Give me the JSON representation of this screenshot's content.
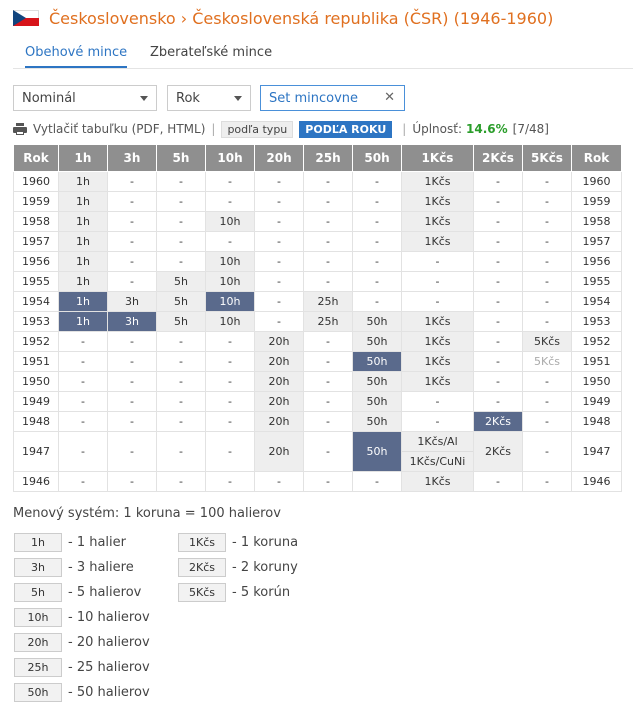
{
  "header": {
    "title": "Československo › Československá republika (ČSR) (1946-1960)",
    "flag": "czechoslovakia-flag"
  },
  "tabs": [
    "Obehové mince",
    "Zberateľské mince"
  ],
  "filters": {
    "nominal": "Nominál",
    "year": "Rok",
    "set": "Set mincovne"
  },
  "toolbar": {
    "print": "Vytlačiť tabuľku (PDF, HTML)",
    "by_type": "podľa typu",
    "by_year": "PODĽA ROKU",
    "completeness_label": "Úplnosť:",
    "completeness_pct": "14.6%",
    "completeness_count": "[7/48]"
  },
  "table": {
    "headers": [
      "Rok",
      "1h",
      "3h",
      "5h",
      "10h",
      "20h",
      "25h",
      "50h",
      "1Kčs",
      "2Kčs",
      "5Kčs",
      "Rok"
    ],
    "rows": [
      {
        "year": "1960",
        "cells": [
          {
            "t": "1h",
            "s": "owned"
          },
          {
            "t": "-"
          },
          {
            "t": "-"
          },
          {
            "t": "-"
          },
          {
            "t": "-"
          },
          {
            "t": "-"
          },
          {
            "t": "-"
          },
          {
            "t": "1Kčs",
            "s": "owned"
          },
          {
            "t": "-"
          },
          {
            "t": "-"
          }
        ]
      },
      {
        "year": "1959",
        "cells": [
          {
            "t": "1h",
            "s": "owned"
          },
          {
            "t": "-"
          },
          {
            "t": "-"
          },
          {
            "t": "-"
          },
          {
            "t": "-"
          },
          {
            "t": "-"
          },
          {
            "t": "-"
          },
          {
            "t": "1Kčs",
            "s": "owned"
          },
          {
            "t": "-"
          },
          {
            "t": "-"
          }
        ]
      },
      {
        "year": "1958",
        "cells": [
          {
            "t": "1h",
            "s": "owned"
          },
          {
            "t": "-"
          },
          {
            "t": "-"
          },
          {
            "t": "10h",
            "s": "owned"
          },
          {
            "t": "-"
          },
          {
            "t": "-"
          },
          {
            "t": "-"
          },
          {
            "t": "1Kčs",
            "s": "owned"
          },
          {
            "t": "-"
          },
          {
            "t": "-"
          }
        ]
      },
      {
        "year": "1957",
        "cells": [
          {
            "t": "1h",
            "s": "owned"
          },
          {
            "t": "-"
          },
          {
            "t": "-"
          },
          {
            "t": "-"
          },
          {
            "t": "-"
          },
          {
            "t": "-"
          },
          {
            "t": "-"
          },
          {
            "t": "1Kčs",
            "s": "owned"
          },
          {
            "t": "-"
          },
          {
            "t": "-"
          }
        ]
      },
      {
        "year": "1956",
        "cells": [
          {
            "t": "1h",
            "s": "owned"
          },
          {
            "t": "-"
          },
          {
            "t": "-"
          },
          {
            "t": "10h",
            "s": "owned"
          },
          {
            "t": "-"
          },
          {
            "t": "-"
          },
          {
            "t": "-"
          },
          {
            "t": "-"
          },
          {
            "t": "-"
          },
          {
            "t": "-"
          }
        ]
      },
      {
        "year": "1955",
        "cells": [
          {
            "t": "1h",
            "s": "owned"
          },
          {
            "t": "-"
          },
          {
            "t": "5h",
            "s": "owned"
          },
          {
            "t": "10h",
            "s": "owned"
          },
          {
            "t": "-"
          },
          {
            "t": "-"
          },
          {
            "t": "-"
          },
          {
            "t": "-"
          },
          {
            "t": "-"
          },
          {
            "t": "-"
          }
        ]
      },
      {
        "year": "1954",
        "cells": [
          {
            "t": "1h",
            "s": "hl"
          },
          {
            "t": "3h",
            "s": "owned"
          },
          {
            "t": "5h",
            "s": "owned"
          },
          {
            "t": "10h",
            "s": "hl"
          },
          {
            "t": "-"
          },
          {
            "t": "25h",
            "s": "owned"
          },
          {
            "t": "-"
          },
          {
            "t": "-"
          },
          {
            "t": "-"
          },
          {
            "t": "-"
          }
        ]
      },
      {
        "year": "1953",
        "cells": [
          {
            "t": "1h",
            "s": "hl"
          },
          {
            "t": "3h",
            "s": "hl"
          },
          {
            "t": "5h",
            "s": "owned"
          },
          {
            "t": "10h",
            "s": "owned"
          },
          {
            "t": "-"
          },
          {
            "t": "25h",
            "s": "owned"
          },
          {
            "t": "50h",
            "s": "owned"
          },
          {
            "t": "1Kčs",
            "s": "owned"
          },
          {
            "t": "-"
          },
          {
            "t": "-"
          }
        ]
      },
      {
        "year": "1952",
        "cells": [
          {
            "t": "-"
          },
          {
            "t": "-"
          },
          {
            "t": "-"
          },
          {
            "t": "-"
          },
          {
            "t": "20h",
            "s": "owned"
          },
          {
            "t": "-"
          },
          {
            "t": "50h",
            "s": "owned"
          },
          {
            "t": "1Kčs",
            "s": "owned"
          },
          {
            "t": "-"
          },
          {
            "t": "5Kčs",
            "s": "owned"
          }
        ]
      },
      {
        "year": "1951",
        "cells": [
          {
            "t": "-"
          },
          {
            "t": "-"
          },
          {
            "t": "-"
          },
          {
            "t": "-"
          },
          {
            "t": "20h",
            "s": "owned"
          },
          {
            "t": "-"
          },
          {
            "t": "50h",
            "s": "hl"
          },
          {
            "t": "1Kčs",
            "s": "owned"
          },
          {
            "t": "-"
          },
          {
            "t": "5Kčs",
            "s": "gray"
          }
        ]
      },
      {
        "year": "1950",
        "cells": [
          {
            "t": "-"
          },
          {
            "t": "-"
          },
          {
            "t": "-"
          },
          {
            "t": "-"
          },
          {
            "t": "20h",
            "s": "owned"
          },
          {
            "t": "-"
          },
          {
            "t": "50h",
            "s": "owned"
          },
          {
            "t": "1Kčs",
            "s": "owned"
          },
          {
            "t": "-"
          },
          {
            "t": "-"
          }
        ]
      },
      {
        "year": "1949",
        "cells": [
          {
            "t": "-"
          },
          {
            "t": "-"
          },
          {
            "t": "-"
          },
          {
            "t": "-"
          },
          {
            "t": "20h",
            "s": "owned"
          },
          {
            "t": "-"
          },
          {
            "t": "50h",
            "s": "owned"
          },
          {
            "t": "-"
          },
          {
            "t": "-"
          },
          {
            "t": "-"
          }
        ]
      },
      {
        "year": "1948",
        "cells": [
          {
            "t": "-"
          },
          {
            "t": "-"
          },
          {
            "t": "-"
          },
          {
            "t": "-"
          },
          {
            "t": "20h",
            "s": "owned"
          },
          {
            "t": "-"
          },
          {
            "t": "50h",
            "s": "owned"
          },
          {
            "t": "-"
          },
          {
            "t": "2Kčs",
            "s": "hl"
          },
          {
            "t": "-"
          }
        ]
      },
      {
        "year": "1947",
        "tall": true,
        "cells": [
          {
            "t": "-"
          },
          {
            "t": "-"
          },
          {
            "t": "-"
          },
          {
            "t": "-"
          },
          {
            "t": "20h",
            "s": "owned"
          },
          {
            "t": "-"
          },
          {
            "t": "50h",
            "s": "hl"
          },
          {
            "t": [
              "1Kčs/Al",
              "1Kčs/CuNi"
            ],
            "s": "owned"
          },
          {
            "t": "2Kčs",
            "s": "owned"
          },
          {
            "t": "-"
          }
        ]
      },
      {
        "year": "1946",
        "cells": [
          {
            "t": "-"
          },
          {
            "t": "-"
          },
          {
            "t": "-"
          },
          {
            "t": "-"
          },
          {
            "t": "-"
          },
          {
            "t": "-"
          },
          {
            "t": "-"
          },
          {
            "t": "1Kčs",
            "s": "owned"
          },
          {
            "t": "-"
          },
          {
            "t": "-"
          }
        ]
      }
    ]
  },
  "legend": {
    "note": "Menový systém: 1 koruna = 100 halierov",
    "left": [
      {
        "chip": "1h",
        "text": "- 1 halier"
      },
      {
        "chip": "3h",
        "text": "- 3 haliere"
      },
      {
        "chip": "5h",
        "text": "- 5 halierov"
      },
      {
        "chip": "10h",
        "text": "- 10 halierov"
      },
      {
        "chip": "20h",
        "text": "- 20 halierov"
      },
      {
        "chip": "25h",
        "text": "- 25 halierov"
      },
      {
        "chip": "50h",
        "text": "- 50 halierov"
      }
    ],
    "right": [
      {
        "chip": "1Kčs",
        "text": "- 1 koruna"
      },
      {
        "chip": "2Kčs",
        "text": "- 2 koruny"
      },
      {
        "chip": "5Kčs",
        "text": "- 5 korún"
      }
    ]
  },
  "colors": {
    "title": "#e07020",
    "accent": "#2d75c3",
    "header_bg": "#8f8f8f",
    "highlight": "#5a6a8c",
    "owned": "#eeeeee",
    "pct": "#2a9d2a"
  }
}
